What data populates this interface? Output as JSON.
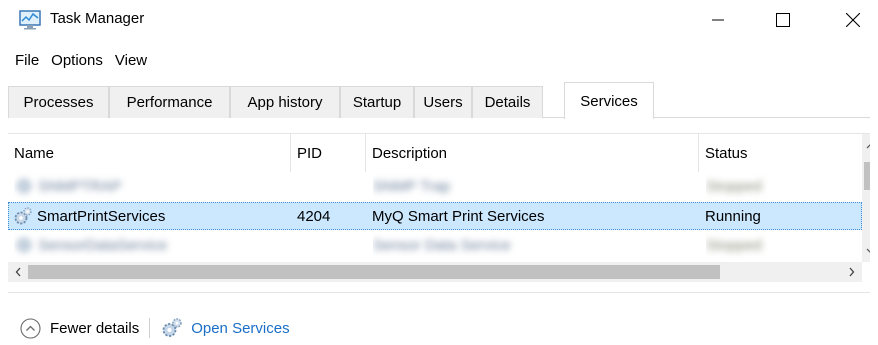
{
  "window": {
    "title": "Task Manager",
    "icons": {
      "app": "task-manager-icon",
      "minimize": "minimize-icon",
      "maximize": "maximize-icon",
      "close": "close-icon"
    }
  },
  "menu": [
    "File",
    "Options",
    "View"
  ],
  "tabs": [
    {
      "label": "Processes",
      "active": false
    },
    {
      "label": "Performance",
      "active": false
    },
    {
      "label": "App history",
      "active": false
    },
    {
      "label": "Startup",
      "active": false
    },
    {
      "label": "Users",
      "active": false
    },
    {
      "label": "Details",
      "active": false
    },
    {
      "label": "Services",
      "active": true
    }
  ],
  "table": {
    "columns": [
      "Name",
      "PID",
      "Description",
      "Status"
    ],
    "rows": [
      {
        "name": "SNMPTRAP",
        "pid": "",
        "description": "SNMP Trap",
        "status": "Stopped",
        "blurred": true,
        "selected": false
      },
      {
        "name": "SmartPrintServices",
        "pid": "4204",
        "description": "MyQ Smart Print Services",
        "status": "Running",
        "blurred": false,
        "selected": true
      },
      {
        "name": "SensorDataService",
        "pid": "",
        "description": "Sensor Data Service",
        "status": "Stopped",
        "blurred": true,
        "selected": false
      }
    ],
    "row_icon": "service-gear-icon"
  },
  "footer": {
    "fewer_details": "Fewer details",
    "open_services": "Open Services",
    "icons": {
      "fewer": "chevron-up-circle-icon",
      "services": "services-gears-icon"
    }
  },
  "colors": {
    "selection": "#cce8ff",
    "selection_border": "#3c8fd6",
    "link": "#1a6fc7",
    "scroll_thumb": "#c1c1c1"
  }
}
